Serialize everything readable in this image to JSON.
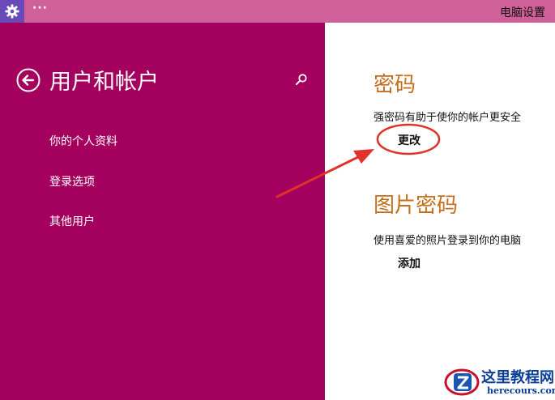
{
  "titlebar": {
    "menu_dots": "···",
    "app_title": "电脑设置",
    "colors": {
      "bar": "#d0609a",
      "gear_bg": "#6a49b8"
    },
    "icons": [
      "gear-icon"
    ]
  },
  "sidebar": {
    "title": "用户和帐户",
    "back_icon": "back-arrow-icon",
    "search_icon": "search-icon",
    "items": [
      {
        "label": "你的个人资料"
      },
      {
        "label": "登录选项"
      },
      {
        "label": "其他用户"
      }
    ],
    "colors": {
      "background": "#a4005d",
      "text": "#ffffff"
    }
  },
  "main": {
    "password": {
      "title": "密码",
      "description": "强密码有助于使你的帐户更安全",
      "action": "更改"
    },
    "picture_password": {
      "title": "图片密码",
      "description": "使用喜爱的照片登录到你的电脑",
      "action": "添加"
    },
    "colors": {
      "section_title": "#c56e1c",
      "annotation": "#e0312c"
    }
  },
  "watermark": {
    "name": "这里教程网",
    "site": "herecours.com"
  }
}
